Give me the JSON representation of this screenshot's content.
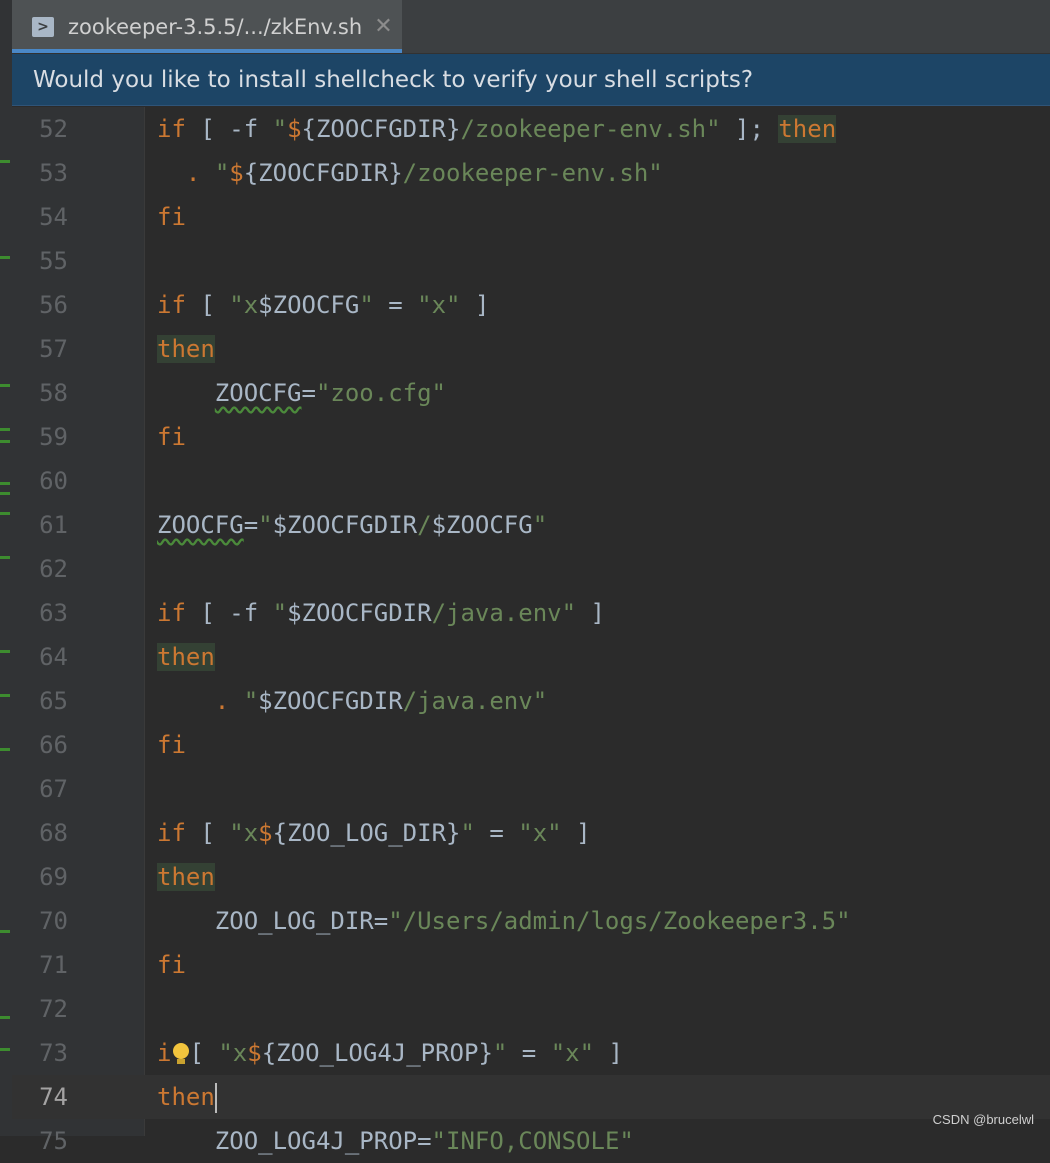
{
  "tab": {
    "title": "zookeeper-3.5.5/.../zkEnv.sh",
    "close_glyph": "✕",
    "icon_glyph": ">"
  },
  "banner": {
    "text": "Would you like to install shellcheck to verify your shell scripts?"
  },
  "colors": {
    "keyword": "#cc7832",
    "string": "#6a8759",
    "text": "#a9b7c6",
    "editor_bg": "#2b2b2b",
    "banner_bg": "#1d4566",
    "tab_accent": "#4a88c7"
  },
  "editor": {
    "current_line": "74",
    "lines": [
      {
        "n": "52",
        "parts": [
          [
            "kw",
            "if"
          ],
          [
            "op",
            " [ -f "
          ],
          [
            "str",
            "\""
          ],
          [
            "kw",
            "$"
          ],
          [
            "op",
            "{ZOOCFGDIR}"
          ],
          [
            "str",
            "/zookeeper-env.sh\""
          ],
          [
            "op",
            " ]; "
          ],
          [
            "kwbg",
            "then"
          ]
        ]
      },
      {
        "n": "53",
        "parts": [
          [
            "op",
            "  "
          ],
          [
            "dot",
            "."
          ],
          [
            "op",
            " "
          ],
          [
            "str",
            "\""
          ],
          [
            "kw",
            "$"
          ],
          [
            "op",
            "{ZOOCFGDIR}"
          ],
          [
            "str",
            "/zookeeper-env.sh\""
          ]
        ]
      },
      {
        "n": "54",
        "parts": [
          [
            "kw",
            "fi"
          ]
        ]
      },
      {
        "n": "55",
        "parts": []
      },
      {
        "n": "56",
        "parts": [
          [
            "kw",
            "if"
          ],
          [
            "op",
            " [ "
          ],
          [
            "str",
            "\"x"
          ],
          [
            "var",
            "$ZOOCFG"
          ],
          [
            "str",
            "\""
          ],
          [
            "op",
            " = "
          ],
          [
            "str",
            "\"x\""
          ],
          [
            "op",
            " ]"
          ]
        ]
      },
      {
        "n": "57",
        "parts": [
          [
            "kwbg",
            "then"
          ]
        ]
      },
      {
        "n": "58",
        "parts": [
          [
            "op",
            "    "
          ],
          [
            "squig",
            "ZOOCFG"
          ],
          [
            "op",
            "="
          ],
          [
            "str",
            "\"zoo.cfg\""
          ]
        ]
      },
      {
        "n": "59",
        "parts": [
          [
            "kw",
            "fi"
          ]
        ]
      },
      {
        "n": "60",
        "parts": []
      },
      {
        "n": "61",
        "parts": [
          [
            "squig",
            "ZOOCFG"
          ],
          [
            "op",
            "="
          ],
          [
            "str",
            "\""
          ],
          [
            "var",
            "$ZOOCFGDIR"
          ],
          [
            "str",
            "/"
          ],
          [
            "var",
            "$ZOOCFG"
          ],
          [
            "str",
            "\""
          ]
        ]
      },
      {
        "n": "62",
        "parts": []
      },
      {
        "n": "63",
        "parts": [
          [
            "kw",
            "if"
          ],
          [
            "op",
            " [ -f "
          ],
          [
            "str",
            "\""
          ],
          [
            "var",
            "$ZOOCFGDIR"
          ],
          [
            "str",
            "/java.env\""
          ],
          [
            "op",
            " ]"
          ]
        ]
      },
      {
        "n": "64",
        "parts": [
          [
            "kwbg",
            "then"
          ]
        ]
      },
      {
        "n": "65",
        "parts": [
          [
            "op",
            "    "
          ],
          [
            "dot",
            "."
          ],
          [
            "op",
            " "
          ],
          [
            "str",
            "\""
          ],
          [
            "var",
            "$ZOOCFGDIR"
          ],
          [
            "str",
            "/java.env\""
          ]
        ]
      },
      {
        "n": "66",
        "parts": [
          [
            "kw",
            "fi"
          ]
        ]
      },
      {
        "n": "67",
        "parts": []
      },
      {
        "n": "68",
        "parts": [
          [
            "kw",
            "if"
          ],
          [
            "op",
            " [ "
          ],
          [
            "str",
            "\"x"
          ],
          [
            "kw",
            "$"
          ],
          [
            "op",
            "{ZOO_LOG_DIR}"
          ],
          [
            "str",
            "\""
          ],
          [
            "op",
            " = "
          ],
          [
            "str",
            "\"x\""
          ],
          [
            "op",
            " ]"
          ]
        ]
      },
      {
        "n": "69",
        "parts": [
          [
            "kwbg",
            "then"
          ]
        ]
      },
      {
        "n": "70",
        "parts": [
          [
            "op",
            "    ZOO_LOG_DIR="
          ],
          [
            "str",
            "\"/Users/admin/logs/Zookeeper3.5\""
          ]
        ]
      },
      {
        "n": "71",
        "parts": [
          [
            "kw",
            "fi"
          ]
        ]
      },
      {
        "n": "72",
        "parts": []
      },
      {
        "n": "73",
        "parts": [
          [
            "kw",
            "i"
          ],
          [
            "bulb",
            ""
          ],
          [
            "op",
            "[ "
          ],
          [
            "str",
            "\"x"
          ],
          [
            "kw",
            "$"
          ],
          [
            "op",
            "{ZOO_LOG4J_PROP}"
          ],
          [
            "str",
            "\""
          ],
          [
            "op",
            " = "
          ],
          [
            "str",
            "\"x\""
          ],
          [
            "op",
            " ]"
          ]
        ]
      },
      {
        "n": "74",
        "parts": [
          [
            "kw",
            "then"
          ],
          [
            "cursor",
            ""
          ]
        ]
      },
      {
        "n": "75",
        "parts": [
          [
            "op",
            "    ZOO_LOG4J_PROP="
          ],
          [
            "str",
            "\"INFO,CONSOLE\""
          ]
        ]
      }
    ]
  },
  "watermark": "CSDN @brucelwl"
}
